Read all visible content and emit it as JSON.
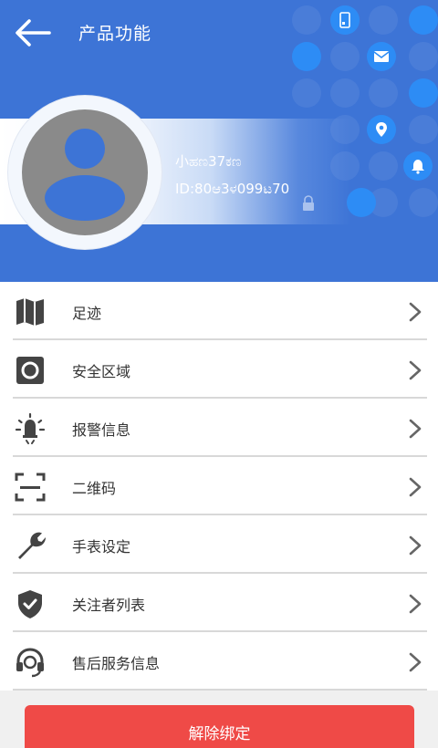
{
  "header": {
    "title": "产品功能",
    "device_name": "小ಹಣ37ಕಣ",
    "device_id": "ID:80ಆ3ಳ099ಟ70",
    "accent": "#3d74d6"
  },
  "menu": [
    {
      "label": "足迹",
      "icon": "map-icon"
    },
    {
      "label": "安全区域",
      "icon": "safe-zone-icon"
    },
    {
      "label": "报警信息",
      "icon": "alarm-light-icon"
    },
    {
      "label": "二维码",
      "icon": "qr-scan-icon"
    },
    {
      "label": "手表设定",
      "icon": "wrench-icon"
    },
    {
      "label": "关注者列表",
      "icon": "shield-check-icon"
    },
    {
      "label": "售后服务信息",
      "icon": "headset-icon"
    }
  ],
  "unbind_button": {
    "label": "解除绑定",
    "color": "#ef4a47"
  }
}
